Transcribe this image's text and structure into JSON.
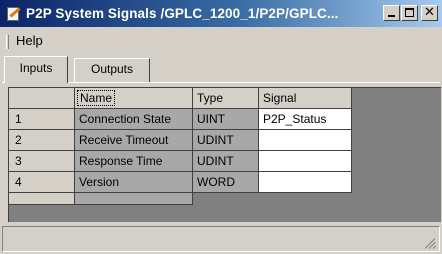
{
  "window": {
    "title": "P2P System Signals /GPLC_1200_1/P2P/GPLC...",
    "icon": "p2p-signals-icon"
  },
  "menu": {
    "items": [
      "Help"
    ]
  },
  "tabs": [
    {
      "label": "Inputs",
      "selected": true
    },
    {
      "label": "Outputs",
      "selected": false
    }
  ],
  "grid": {
    "columns": [
      "Name",
      "Type",
      "Signal"
    ],
    "rows": [
      {
        "index": "1",
        "name": "Connection State",
        "type": "UINT",
        "signal": "P2P_Status"
      },
      {
        "index": "2",
        "name": "Receive Timeout",
        "type": "UDINT",
        "signal": ""
      },
      {
        "index": "3",
        "name": "Response Time",
        "type": "UDINT",
        "signal": ""
      },
      {
        "index": "4",
        "name": "Version",
        "type": "WORD",
        "signal": ""
      }
    ]
  },
  "colors": {
    "titlebar_start": "#0a246a",
    "titlebar_end": "#a6caf0",
    "face": "#d4d0c8",
    "readonly_cell": "#a8a8a8",
    "grid_background": "#808080"
  }
}
